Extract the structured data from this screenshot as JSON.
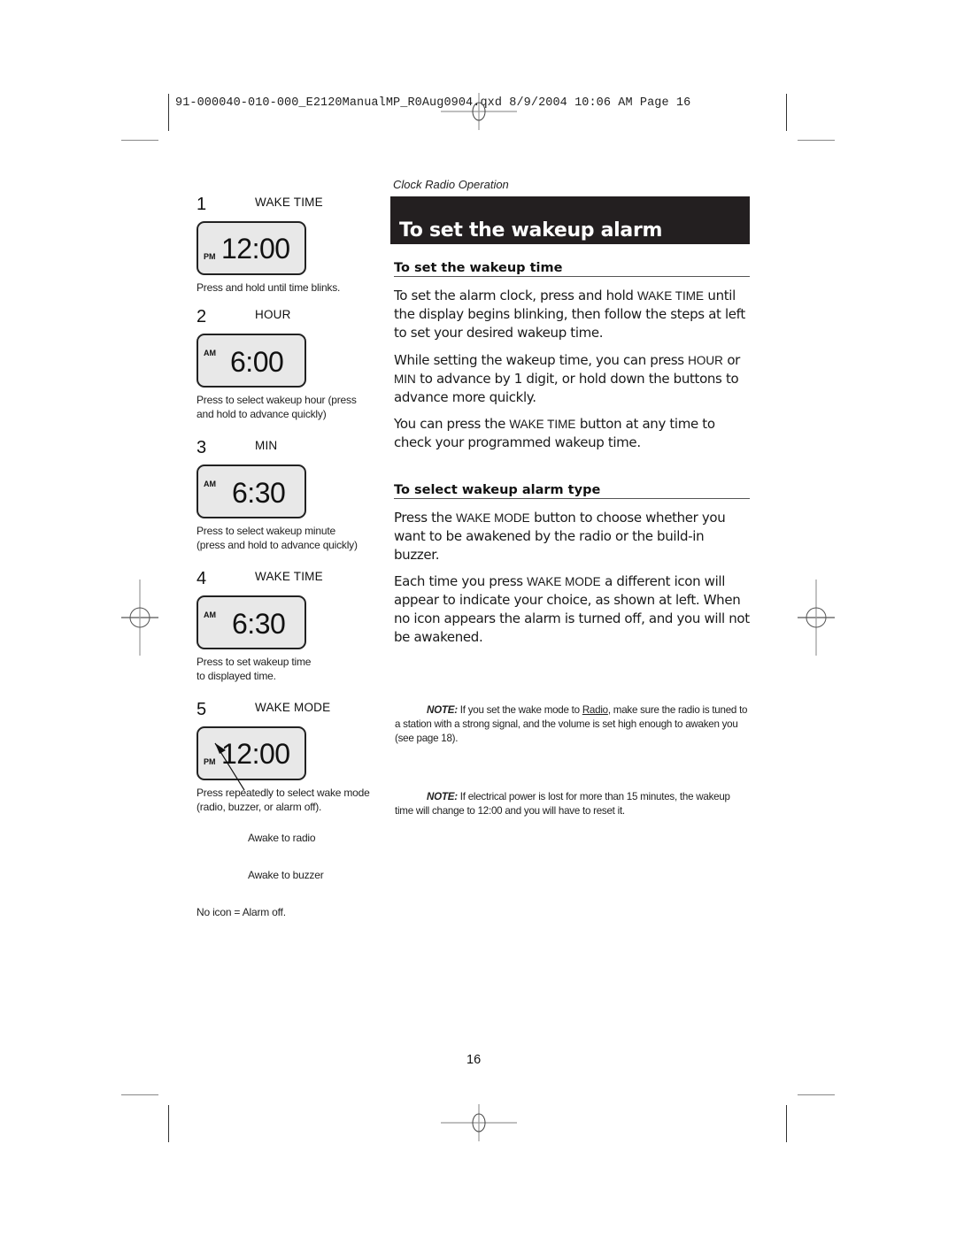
{
  "print_slug": "91-000040-010-000_E2120ManualMP_R0Aug0904.qxd  8/9/2004  10:06 AM  Page 16",
  "section_label": "Clock Radio Operation",
  "banner_title": "To set the wakeup alarm",
  "steps": [
    {
      "number": "1",
      "button": "WAKE TIME",
      "ampm": "PM",
      "time": "12:00",
      "caption": [
        "Press and hold until time blinks."
      ]
    },
    {
      "number": "2",
      "button": "HOUR",
      "ampm": "AM",
      "time": "6:00",
      "caption": [
        "Press to select wakeup hour (press",
        "and hold to advance quickly)"
      ]
    },
    {
      "number": "3",
      "button": "MIN",
      "ampm": "AM",
      "time": "6:30",
      "caption": [
        "Press to select wakeup minute",
        "(press and hold to advance quickly)"
      ]
    },
    {
      "number": "4",
      "button": "WAKE TIME",
      "ampm": "AM",
      "time": "6:30",
      "caption": [
        "Press to set wakeup time",
        "to displayed time."
      ]
    },
    {
      "number": "5",
      "button": "WAKE MODE",
      "ampm": "PM",
      "time": "12:00",
      "caption": [
        "Press repeatedly to select wake mode",
        "(radio, buzzer, or alarm off)."
      ]
    }
  ],
  "wake_mode_legend": {
    "radio": "Awake to radio",
    "buzzer": "Awake to buzzer",
    "off": "No icon = Alarm off."
  },
  "section1": {
    "heading": "To set the wakeup time",
    "p1": {
      "a": "To set the alarm clock, press and hold ",
      "key": "WAKE TIME",
      "b": "  until the display begins blinking, then follow the steps at left to set your desired wakeup time."
    },
    "p2": {
      "a": "While setting the wakeup time, you can press ",
      "key1": "HOUR",
      "b": " or ",
      "key2": "MIN",
      "c": "  to advance by 1 digit, or hold down the buttons to advance more quickly."
    },
    "p3": {
      "a": "You can press the ",
      "key": "WAKE TIME",
      "b": "  button at any time to check your programmed wakeup time."
    }
  },
  "section2": {
    "heading": "To select wakeup alarm type",
    "p1": {
      "a": "Press the ",
      "key": "WAKE MODE",
      "b": "  button to choose whether you want to be awakened by the radio or the build-in buzzer."
    },
    "p2": {
      "a": "Each time you press ",
      "key": "WAKE MODE",
      "b": "  a different icon will appear to indicate your choice, as shown at left. When no icon appears the alarm is turned off, and you will not be awakened."
    }
  },
  "notes": [
    {
      "label": "NOTE:",
      "a": " If you set the wake mode to ",
      "link": "Radio",
      "b": ", make sure the radio is tuned to a station with a strong signal, and the volume is set high enough to awaken you (see page 18)."
    },
    {
      "label": "NOTE:",
      "a": " If electrical power is lost for more than 15 minutes, the wakeup time will change to 12:00 and you will have to reset it."
    }
  ],
  "page_number": "16"
}
